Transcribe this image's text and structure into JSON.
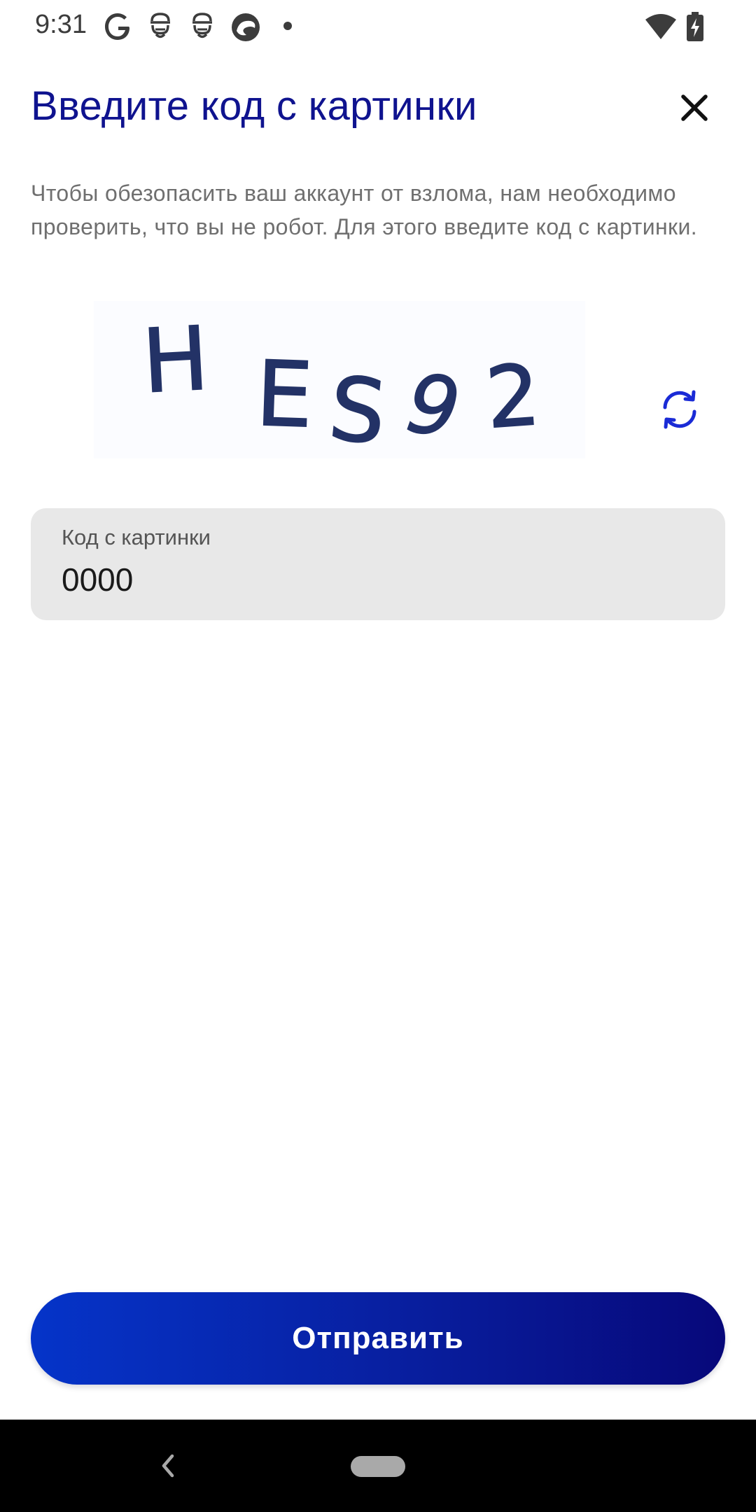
{
  "status_bar": {
    "time": "9:31",
    "notification_icons": [
      "google-icon",
      "notification-app-icon",
      "notification-app-icon",
      "browser-icon",
      "dot-icon"
    ],
    "system_icons": [
      "wifi-icon",
      "battery-charging-icon"
    ]
  },
  "header": {
    "title": "Введите код с картинки",
    "close_icon": "close-icon"
  },
  "description": "Чтобы обезопасить ваш аккаунт от взлома, нам необходимо проверить, что вы не робот. Для этого введите код с картинки.",
  "captcha": {
    "characters": [
      "H",
      "E",
      "S",
      "9",
      "2"
    ],
    "refresh_icon": "refresh-icon"
  },
  "code_field": {
    "label": "Код с картинки",
    "value": "0000"
  },
  "submit_button": {
    "label": "Отправить"
  },
  "colors": {
    "title": "#0f138f",
    "accent": "#1a2bd6",
    "button_gradient_start": "#0534c9",
    "button_gradient_end": "#07087a",
    "field_background": "#e8e8e8"
  }
}
